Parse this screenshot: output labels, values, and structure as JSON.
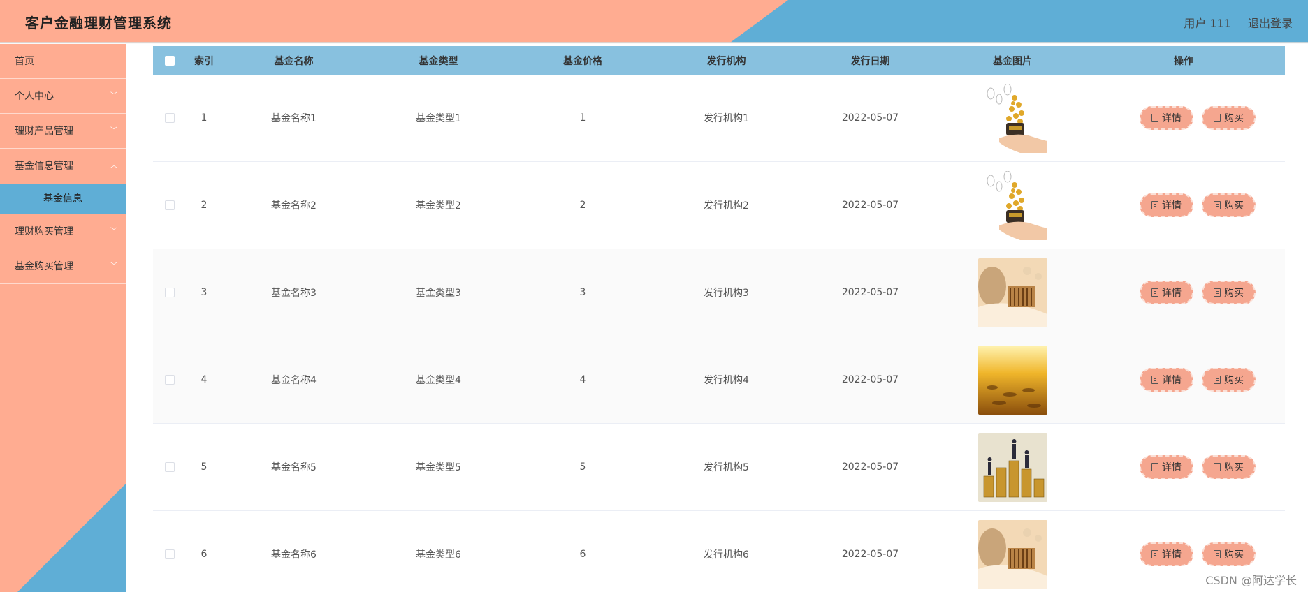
{
  "header": {
    "title": "客户金融理财管理系统",
    "user": "用户 111",
    "logout": "退出登录"
  },
  "sidebar": {
    "items": [
      {
        "label": "首页"
      },
      {
        "label": "个人中心"
      },
      {
        "label": "理财产品管理"
      },
      {
        "label": "基金信息管理"
      },
      {
        "label": "基金信息"
      },
      {
        "label": "理财购买管理"
      },
      {
        "label": "基金购买管理"
      }
    ]
  },
  "table": {
    "columns": [
      "索引",
      "基金名称",
      "基金类型",
      "基金价格",
      "发行机构",
      "发行日期",
      "基金图片",
      "操作"
    ],
    "rows": [
      {
        "index": "1",
        "name": "基金名称1",
        "type": "基金类型1",
        "price": "1",
        "org": "发行机构1",
        "date": "2022-05-07",
        "image": "coins-hand-image"
      },
      {
        "index": "2",
        "name": "基金名称2",
        "type": "基金类型2",
        "price": "2",
        "org": "发行机构2",
        "date": "2022-05-07",
        "image": "coins-hand-image"
      },
      {
        "index": "3",
        "name": "基金名称3",
        "type": "基金类型3",
        "price": "3",
        "org": "发行机构3",
        "date": "2022-05-07",
        "image": "abacus-money-image"
      },
      {
        "index": "4",
        "name": "基金名称4",
        "type": "基金类型4",
        "price": "4",
        "org": "发行机构4",
        "date": "2022-05-07",
        "image": "gold-coins-image"
      },
      {
        "index": "5",
        "name": "基金名称5",
        "type": "基金类型5",
        "price": "5",
        "org": "发行机构5",
        "date": "2022-05-07",
        "image": "business-coin-stacks-image"
      },
      {
        "index": "6",
        "name": "基金名称6",
        "type": "基金类型6",
        "price": "6",
        "org": "发行机构6",
        "date": "2022-05-07",
        "image": "abacus-money-image"
      }
    ],
    "actions": {
      "detail": "详情",
      "buy": "购买"
    }
  },
  "watermark": "CSDN @阿达学长",
  "colors": {
    "salmon": "#ffac91",
    "blue": "#5faed6",
    "table_header": "#88c1df",
    "button": "#f5a68f"
  }
}
